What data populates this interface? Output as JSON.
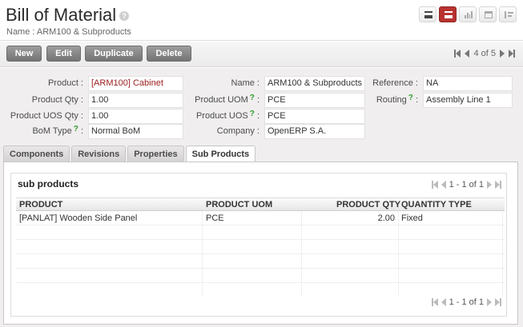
{
  "header": {
    "title": "Bill of Material",
    "help": "?",
    "subtitle": "Name : ARM100 & Subproducts"
  },
  "view_switcher": [
    {
      "name": "list-view",
      "icon": "list-icon",
      "active": false
    },
    {
      "name": "form-view",
      "icon": "form-icon",
      "active": true
    },
    {
      "name": "graph-view",
      "icon": "bar-chart-icon",
      "active": false
    },
    {
      "name": "calendar-view",
      "icon": "calendar-icon",
      "active": false
    },
    {
      "name": "tree-view",
      "icon": "tree-icon",
      "active": false
    }
  ],
  "toolbar": {
    "new_label": "New",
    "edit_label": "Edit",
    "duplicate_label": "Duplicate",
    "delete_label": "Delete",
    "pager_text": "4 of 5"
  },
  "form": {
    "product": {
      "label": "Product :",
      "value": "[ARM100] Cabinet"
    },
    "product_qty": {
      "label": "Product Qty :",
      "value": "1.00"
    },
    "product_uos_qty": {
      "label": "Product UOS Qty :",
      "value": "1.00"
    },
    "bom_type": {
      "label": "BoM Type",
      "value": "Normal BoM"
    },
    "name": {
      "label": "Name :",
      "value": "ARM100 & Subproducts"
    },
    "product_uom": {
      "label": "Product UOM",
      "value": "PCE"
    },
    "product_uos": {
      "label": "Product UOS",
      "value": "PCE"
    },
    "company": {
      "label": "Company :",
      "value": "OpenERP S.A."
    },
    "reference": {
      "label": "Reference :",
      "value": "NA"
    },
    "routing": {
      "label": "Routing",
      "value": "Assembly Line 1"
    },
    "help_mark": "?",
    "colon": ":"
  },
  "tabs": [
    {
      "label": "Components",
      "active": false
    },
    {
      "label": "Revisions",
      "active": false
    },
    {
      "label": "Properties",
      "active": false
    },
    {
      "label": "Sub Products",
      "active": true
    }
  ],
  "sub_products": {
    "title": "sub products",
    "pager_text": "1 - 1 of 1",
    "columns": [
      "PRODUCT",
      "PRODUCT UOM",
      "PRODUCT QTY",
      "QUANTITY TYPE"
    ],
    "rows": [
      {
        "product": "[PANLAT] Wooden Side Panel",
        "uom": "PCE",
        "qty": "2.00",
        "type": "Fixed"
      }
    ]
  },
  "colors": {
    "accent": "#b83330",
    "link": "#9b1c1c",
    "help_green": "#2f9c2f"
  }
}
